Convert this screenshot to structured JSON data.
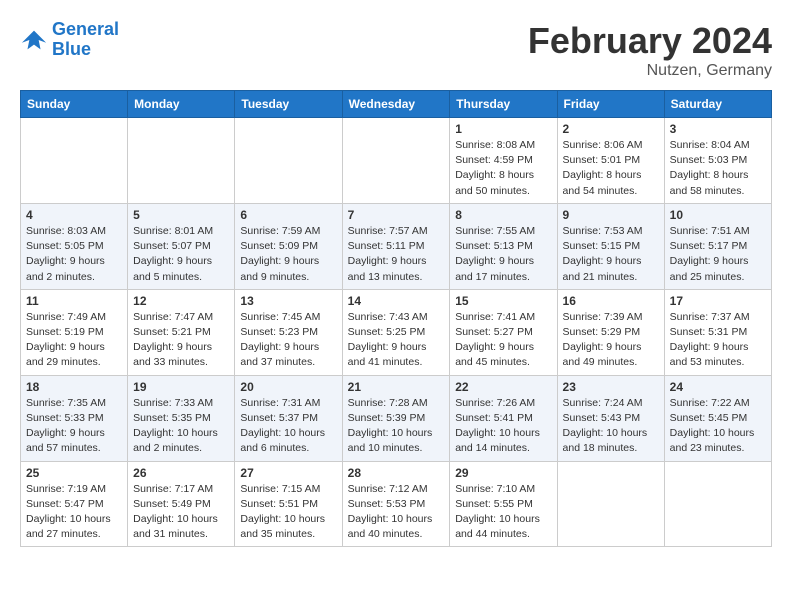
{
  "header": {
    "logo_line1": "General",
    "logo_line2": "Blue",
    "title": "February 2024",
    "subtitle": "Nutzen, Germany"
  },
  "columns": [
    "Sunday",
    "Monday",
    "Tuesday",
    "Wednesday",
    "Thursday",
    "Friday",
    "Saturday"
  ],
  "weeks": [
    [
      {
        "day": "",
        "info": ""
      },
      {
        "day": "",
        "info": ""
      },
      {
        "day": "",
        "info": ""
      },
      {
        "day": "",
        "info": ""
      },
      {
        "day": "1",
        "info": "Sunrise: 8:08 AM\nSunset: 4:59 PM\nDaylight: 8 hours\nand 50 minutes."
      },
      {
        "day": "2",
        "info": "Sunrise: 8:06 AM\nSunset: 5:01 PM\nDaylight: 8 hours\nand 54 minutes."
      },
      {
        "day": "3",
        "info": "Sunrise: 8:04 AM\nSunset: 5:03 PM\nDaylight: 8 hours\nand 58 minutes."
      }
    ],
    [
      {
        "day": "4",
        "info": "Sunrise: 8:03 AM\nSunset: 5:05 PM\nDaylight: 9 hours\nand 2 minutes."
      },
      {
        "day": "5",
        "info": "Sunrise: 8:01 AM\nSunset: 5:07 PM\nDaylight: 9 hours\nand 5 minutes."
      },
      {
        "day": "6",
        "info": "Sunrise: 7:59 AM\nSunset: 5:09 PM\nDaylight: 9 hours\nand 9 minutes."
      },
      {
        "day": "7",
        "info": "Sunrise: 7:57 AM\nSunset: 5:11 PM\nDaylight: 9 hours\nand 13 minutes."
      },
      {
        "day": "8",
        "info": "Sunrise: 7:55 AM\nSunset: 5:13 PM\nDaylight: 9 hours\nand 17 minutes."
      },
      {
        "day": "9",
        "info": "Sunrise: 7:53 AM\nSunset: 5:15 PM\nDaylight: 9 hours\nand 21 minutes."
      },
      {
        "day": "10",
        "info": "Sunrise: 7:51 AM\nSunset: 5:17 PM\nDaylight: 9 hours\nand 25 minutes."
      }
    ],
    [
      {
        "day": "11",
        "info": "Sunrise: 7:49 AM\nSunset: 5:19 PM\nDaylight: 9 hours\nand 29 minutes."
      },
      {
        "day": "12",
        "info": "Sunrise: 7:47 AM\nSunset: 5:21 PM\nDaylight: 9 hours\nand 33 minutes."
      },
      {
        "day": "13",
        "info": "Sunrise: 7:45 AM\nSunset: 5:23 PM\nDaylight: 9 hours\nand 37 minutes."
      },
      {
        "day": "14",
        "info": "Sunrise: 7:43 AM\nSunset: 5:25 PM\nDaylight: 9 hours\nand 41 minutes."
      },
      {
        "day": "15",
        "info": "Sunrise: 7:41 AM\nSunset: 5:27 PM\nDaylight: 9 hours\nand 45 minutes."
      },
      {
        "day": "16",
        "info": "Sunrise: 7:39 AM\nSunset: 5:29 PM\nDaylight: 9 hours\nand 49 minutes."
      },
      {
        "day": "17",
        "info": "Sunrise: 7:37 AM\nSunset: 5:31 PM\nDaylight: 9 hours\nand 53 minutes."
      }
    ],
    [
      {
        "day": "18",
        "info": "Sunrise: 7:35 AM\nSunset: 5:33 PM\nDaylight: 9 hours\nand 57 minutes."
      },
      {
        "day": "19",
        "info": "Sunrise: 7:33 AM\nSunset: 5:35 PM\nDaylight: 10 hours\nand 2 minutes."
      },
      {
        "day": "20",
        "info": "Sunrise: 7:31 AM\nSunset: 5:37 PM\nDaylight: 10 hours\nand 6 minutes."
      },
      {
        "day": "21",
        "info": "Sunrise: 7:28 AM\nSunset: 5:39 PM\nDaylight: 10 hours\nand 10 minutes."
      },
      {
        "day": "22",
        "info": "Sunrise: 7:26 AM\nSunset: 5:41 PM\nDaylight: 10 hours\nand 14 minutes."
      },
      {
        "day": "23",
        "info": "Sunrise: 7:24 AM\nSunset: 5:43 PM\nDaylight: 10 hours\nand 18 minutes."
      },
      {
        "day": "24",
        "info": "Sunrise: 7:22 AM\nSunset: 5:45 PM\nDaylight: 10 hours\nand 23 minutes."
      }
    ],
    [
      {
        "day": "25",
        "info": "Sunrise: 7:19 AM\nSunset: 5:47 PM\nDaylight: 10 hours\nand 27 minutes."
      },
      {
        "day": "26",
        "info": "Sunrise: 7:17 AM\nSunset: 5:49 PM\nDaylight: 10 hours\nand 31 minutes."
      },
      {
        "day": "27",
        "info": "Sunrise: 7:15 AM\nSunset: 5:51 PM\nDaylight: 10 hours\nand 35 minutes."
      },
      {
        "day": "28",
        "info": "Sunrise: 7:12 AM\nSunset: 5:53 PM\nDaylight: 10 hours\nand 40 minutes."
      },
      {
        "day": "29",
        "info": "Sunrise: 7:10 AM\nSunset: 5:55 PM\nDaylight: 10 hours\nand 44 minutes."
      },
      {
        "day": "",
        "info": ""
      },
      {
        "day": "",
        "info": ""
      }
    ]
  ]
}
